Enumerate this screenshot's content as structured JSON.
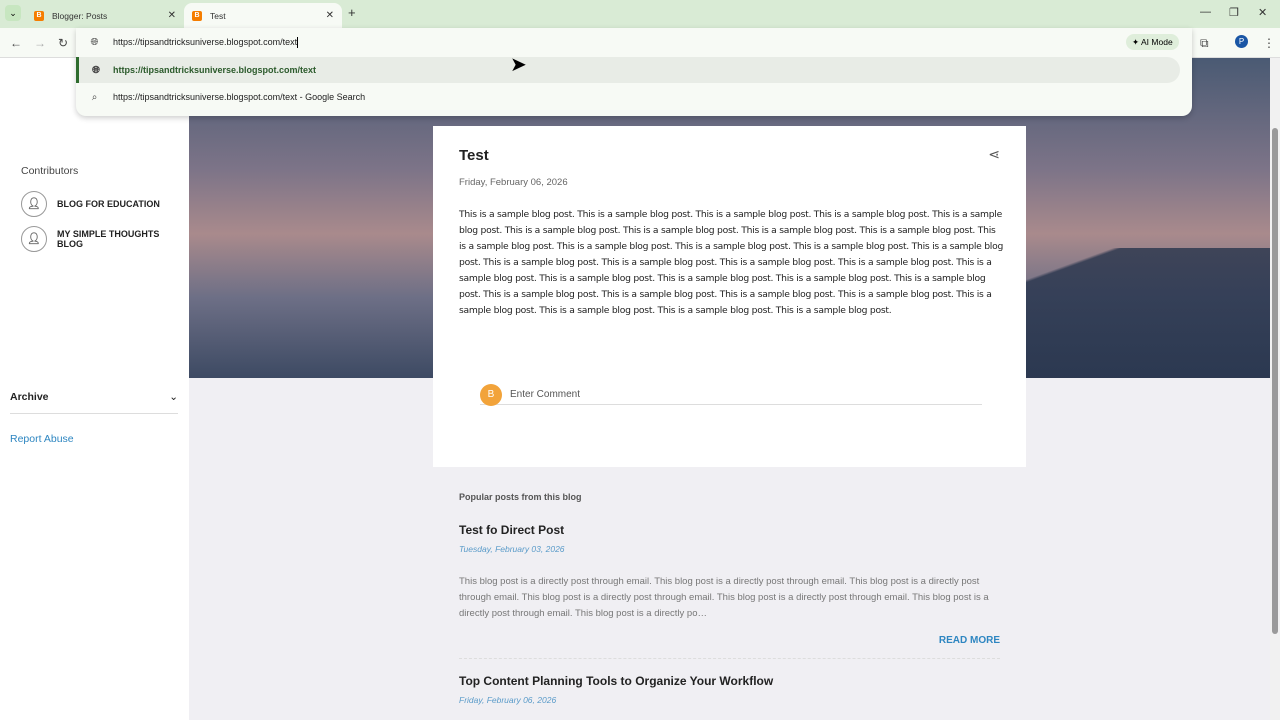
{
  "browser": {
    "tabs": [
      {
        "label": "Blogger: Posts"
      },
      {
        "label": "Test"
      }
    ],
    "address": "https://tipsandtricksuniverse.blogspot.com/text",
    "suggestions": [
      {
        "text": "https://tipsandtricksuniverse.blogspot.com/text"
      },
      {
        "text": "https://tipsandtricksuniverse.blogspot.com/text - Google Search"
      }
    ],
    "ai_mode": "AI Mode",
    "profile": "P"
  },
  "sidebar": {
    "contributors_title": "Contributors",
    "contributors": [
      "BLOG FOR EDUCATION",
      "MY SIMPLE THOUGHTS BLOG"
    ],
    "archive": "Archive",
    "report": "Report Abuse"
  },
  "post": {
    "title": "Test",
    "date": "Friday, February 06, 2026",
    "body": "This is a sample blog post. This is a sample blog post. This is a sample blog post. This is a sample blog post. This is a sample blog post. This is a sample blog post. This is a sample blog post. This is a sample blog post. This is a sample blog post. This is a sample blog post. This is a sample blog post. This is a sample blog post. This is a sample blog post. This is a sample blog post. This is a sample blog post. This is a sample blog post. This is a sample blog post. This is a sample blog post. This is a sample blog post. This is a sample blog post. This is a sample blog post. This is a sample blog post. This is a sample blog post. This is a sample blog post. This is a sample blog post. This is a sample blog post. This is a sample blog post. This is a sample blog post. This is a sample blog post. This is a sample blog post. This is a sample blog post.",
    "comment_placeholder": "Enter Comment"
  },
  "popular": {
    "heading": "Popular posts from this blog",
    "items": [
      {
        "title": "Test fo Direct Post",
        "date": "Tuesday, February 03, 2026",
        "snippet": "This blog post is a directly post through email. This blog post is a directly post through email. This blog post is a directly post through email. This blog post is a directly post through email. This blog post is a directly post through email. This blog post is a directly post through email. This blog post is a directly po…",
        "read_more": "READ MORE"
      },
      {
        "title": "Top Content Planning Tools to Organize Your Workflow",
        "date": "Friday, February 06, 2026"
      }
    ]
  }
}
